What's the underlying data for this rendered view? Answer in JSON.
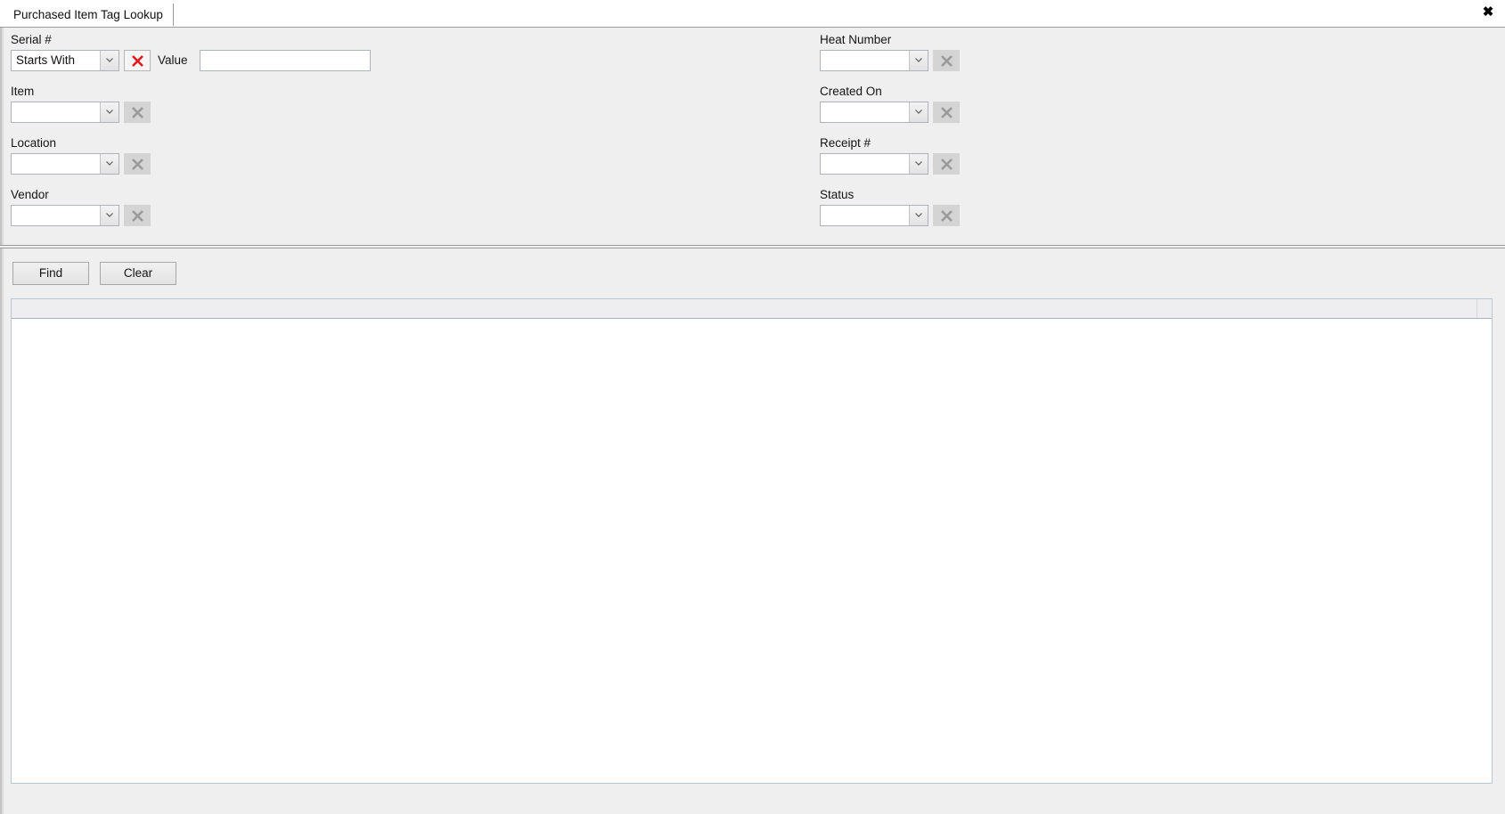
{
  "window": {
    "title": "Purchased Item Tag Lookup",
    "close_label": "✖",
    "background_color": "#efeff0"
  },
  "tabs": [
    {
      "label": "Purchased Item Tag Lookup",
      "active": true
    }
  ],
  "criteria": {
    "left_column": [
      {
        "name": "serial-number",
        "label": "Serial #",
        "operator_value": "Starts With",
        "clear_enabled": true,
        "clear_icon": "red-x-icon",
        "value_label": "Value",
        "value_text": "",
        "value_placeholder": ""
      },
      {
        "name": "item",
        "label": "Item",
        "selected": "",
        "clear_enabled": false,
        "clear_icon": "gray-x-icon"
      },
      {
        "name": "location",
        "label": "Location",
        "selected": "",
        "clear_enabled": false,
        "clear_icon": "gray-x-icon"
      },
      {
        "name": "vendor",
        "label": "Vendor",
        "selected": "",
        "clear_enabled": false,
        "clear_icon": "gray-x-icon"
      }
    ],
    "right_column": [
      {
        "name": "heat-number",
        "label": "Heat Number",
        "selected": "",
        "clear_enabled": false,
        "clear_icon": "gray-x-icon"
      },
      {
        "name": "created-on",
        "label": "Created On",
        "selected": "",
        "clear_enabled": false,
        "clear_icon": "gray-x-icon"
      },
      {
        "name": "receipt-number",
        "label": "Receipt #",
        "selected": "",
        "clear_enabled": false,
        "clear_icon": "gray-x-icon"
      },
      {
        "name": "status",
        "label": "Status",
        "selected": "",
        "clear_enabled": false,
        "clear_icon": "gray-x-icon"
      }
    ]
  },
  "actions": {
    "find_label": "Find",
    "clear_label": "Clear"
  },
  "results": {
    "columns": [],
    "rows": [],
    "empty": true
  },
  "colors": {
    "accent_red": "#e01b1b",
    "disabled_gray": "#9a9a9a",
    "panel": "#efeff0",
    "grid_border": "#b9c6d4"
  }
}
